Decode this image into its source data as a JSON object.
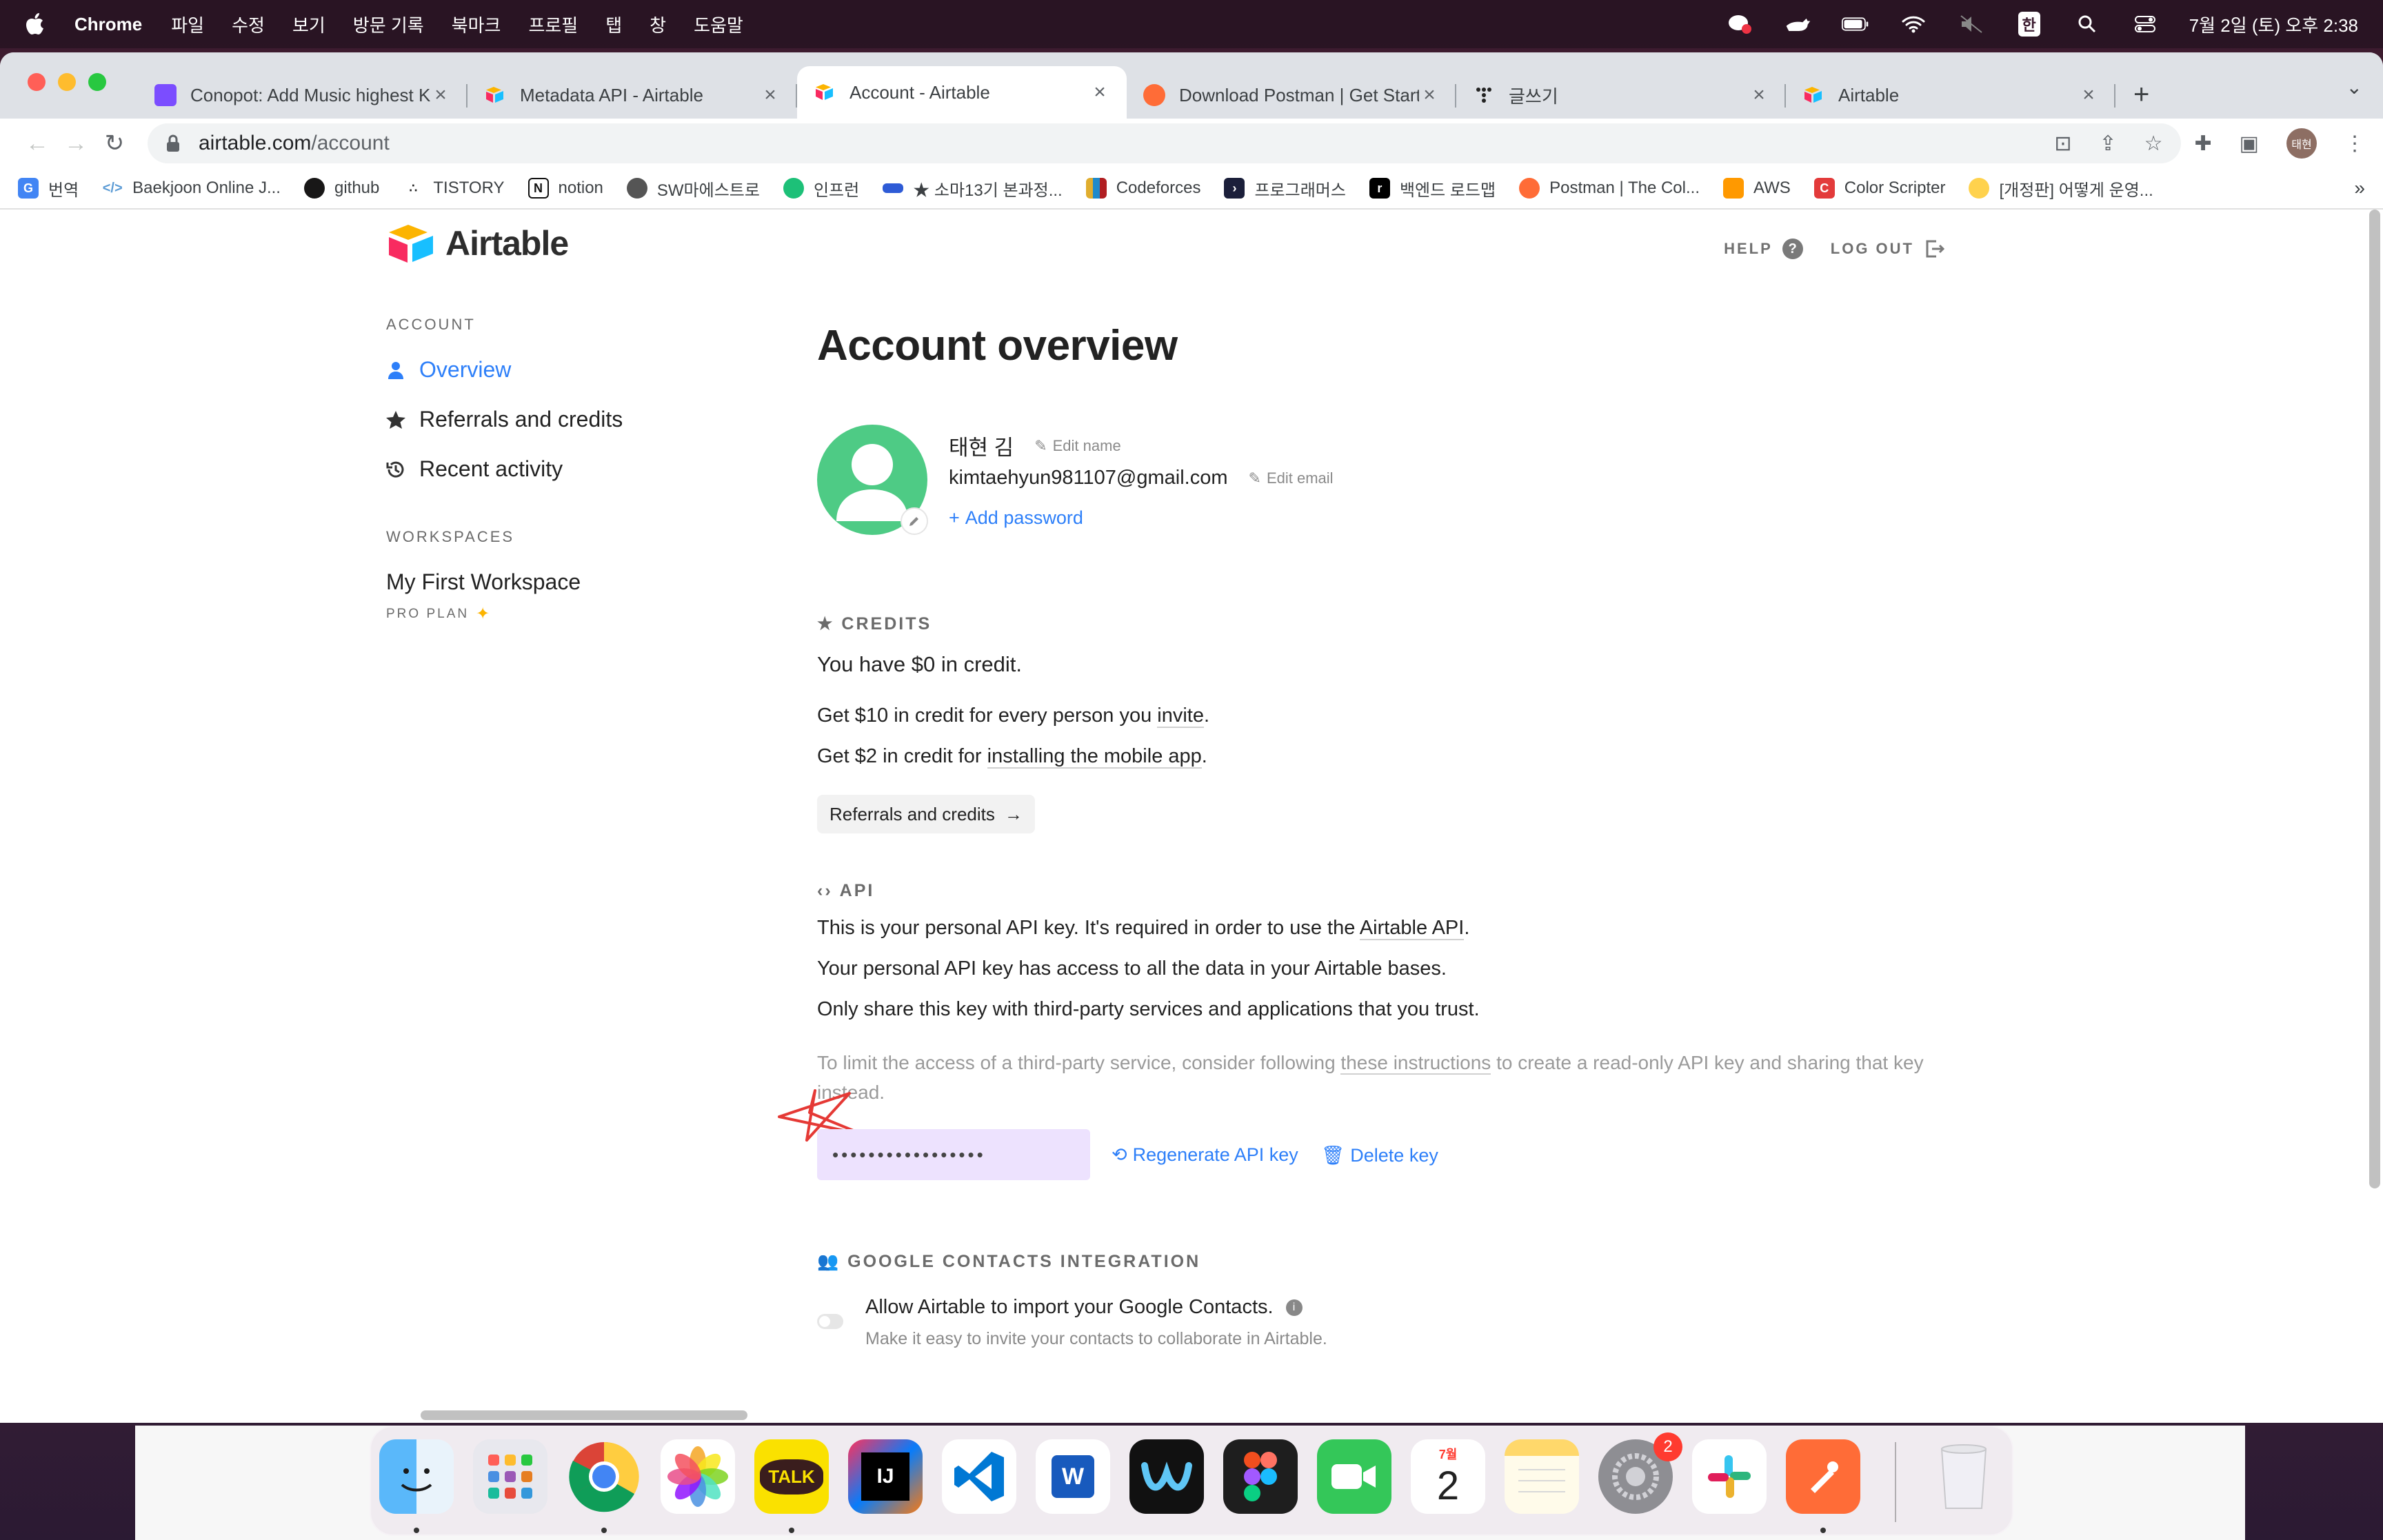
{
  "menubar": {
    "app_name": "Chrome",
    "menus": [
      "파일",
      "수정",
      "보기",
      "방문 기록",
      "북마크",
      "프로필",
      "탭",
      "창",
      "도움말"
    ],
    "datetime": "7월 2일 (토) 오후 2:38",
    "input_method": "한"
  },
  "browser": {
    "tabs": [
      {
        "title": "Conopot: Add Music highest Ke",
        "favicon": "rocket",
        "color": "#7b4dff"
      },
      {
        "title": "Metadata API - Airtable",
        "favicon": "airtable",
        "color": "#fcb400"
      },
      {
        "title": "Account - Airtable",
        "favicon": "airtable",
        "color": "#fcb400",
        "active": true
      },
      {
        "title": "Download Postman | Get Starte",
        "favicon": "postman",
        "color": "#ff6c37"
      },
      {
        "title": "글쓰기",
        "favicon": "tistory",
        "color": "#222222"
      },
      {
        "title": "Airtable",
        "favicon": "airtable",
        "color": "#fcb400"
      }
    ],
    "url_host": "airtable.com",
    "url_path": "/account",
    "profile_label": "태현",
    "bookmarks": [
      {
        "label": "번역",
        "icon_color": "#4285f4",
        "glyph": "G"
      },
      {
        "label": "Baekjoon Online J...",
        "icon_color": "#5b9bd5",
        "glyph": "</>"
      },
      {
        "label": "github",
        "icon_color": "#181717",
        "glyph": "●"
      },
      {
        "label": "TISTORY",
        "icon_color": "#222222",
        "glyph": "∴"
      },
      {
        "label": "notion",
        "icon_color": "#111111",
        "glyph": "N"
      },
      {
        "label": "SW마에스트로",
        "icon_color": "#555555",
        "glyph": "◍"
      },
      {
        "label": "인프런",
        "icon_color": "#1dc078",
        "glyph": "◎"
      },
      {
        "label": "★ 소마13기 본과정...",
        "icon_color": "#2e5bd6",
        "glyph": "▪▪"
      },
      {
        "label": "Codeforces",
        "icon_color": "#e0ad2e",
        "glyph": "▮"
      },
      {
        "label": "프로그래머스",
        "icon_color": "#1b1f3a",
        "glyph": "›"
      },
      {
        "label": "백엔드 로드맵",
        "icon_color": "#000000",
        "glyph": "r"
      },
      {
        "label": "Postman | The Col...",
        "icon_color": "#ff6c37",
        "glyph": "◐"
      },
      {
        "label": "AWS",
        "icon_color": "#ff9900",
        "glyph": "◆"
      },
      {
        "label": "Color Scripter",
        "icon_color": "#e33b3b",
        "glyph": "C"
      },
      {
        "label": "[개정판] 어떻게 운영...",
        "icon_color": "#ffd24d",
        "glyph": "●"
      }
    ]
  },
  "page": {
    "brand": "Airtable",
    "help_label": "HELP",
    "logout_label": "LOG OUT",
    "sidebar": {
      "account_heading": "ACCOUNT",
      "items": [
        {
          "label": "Overview",
          "icon": "user-icon",
          "active": true
        },
        {
          "label": "Referrals and credits",
          "icon": "star-icon"
        },
        {
          "label": "Recent activity",
          "icon": "history-icon"
        }
      ],
      "workspaces_heading": "WORKSPACES",
      "workspace_name": "My First Workspace",
      "workspace_plan": "PRO PLAN"
    },
    "title": "Account overview",
    "profile": {
      "name": "태현 김",
      "edit_name": "Edit name",
      "email": "kimtaehyun981107@gmail.com",
      "edit_email": "Edit email",
      "add_password": "Add password"
    },
    "credits": {
      "heading": "CREDITS",
      "balance": "You have $0 in credit.",
      "line1_prefix": "Get $10 in credit for every person you ",
      "line1_link": "invite",
      "line1_suffix": ".",
      "line2_prefix": "Get $2 in credit for ",
      "line2_link": "installing the mobile app",
      "line2_suffix": ".",
      "button": "Referrals and credits"
    },
    "api": {
      "heading": "API",
      "line1_prefix": "This is your personal API key. It's required in order to use the ",
      "line1_link": "Airtable API",
      "line1_suffix": ".",
      "line2": "Your personal API key has access to all the data in your Airtable bases.",
      "line3": "Only share this key with third-party services and applications that you trust.",
      "note_prefix": "To limit the access of a third-party service, consider following ",
      "note_link": "these instructions",
      "note_suffix": " to create a read-only API key and sharing that key instead.",
      "masked_key": "•••••••••••••••••",
      "regenerate": "Regenerate API key",
      "delete": "Delete key"
    },
    "google": {
      "heading": "GOOGLE CONTACTS INTEGRATION",
      "toggle_label": "Allow Airtable to import your Google Contacts.",
      "toggle_desc": "Make it easy to invite your contacts to collaborate in Airtable.",
      "enabled": false
    }
  },
  "dock": {
    "apps": [
      {
        "name": "Finder",
        "color": "#3ca0f5",
        "running": true
      },
      {
        "name": "Launchpad",
        "color": "#e8e8ee"
      },
      {
        "name": "Chrome",
        "color": "#ffffff",
        "running": true
      },
      {
        "name": "Photos",
        "color": "#ffffff"
      },
      {
        "name": "KakaoTalk",
        "color": "#fae100",
        "label": "TALK",
        "running": true
      },
      {
        "name": "IntelliJ IDEA",
        "color": "#000000",
        "label": "IJ"
      },
      {
        "name": "VS Code",
        "color": "#ffffff"
      },
      {
        "name": "Word",
        "color": "#185abd",
        "label": "W"
      },
      {
        "name": "Webex",
        "color": "#111111"
      },
      {
        "name": "Figma",
        "color": "#1e1e1e"
      },
      {
        "name": "FaceTime",
        "color": "#34c759"
      },
      {
        "name": "Calendar",
        "color": "#ffffff",
        "label": "2",
        "month": "7월"
      },
      {
        "name": "Notes",
        "color": "#fff7c2"
      },
      {
        "name": "System Preferences",
        "color": "#8e8e93",
        "badge": "2"
      },
      {
        "name": "Slack",
        "color": "#ffffff"
      },
      {
        "name": "Postman",
        "color": "#ff6c37",
        "running": true
      },
      {
        "name": "Trash",
        "color": "#f0f0f0"
      }
    ]
  },
  "colors": {
    "airtable_blue": "#2d7ff9",
    "avatar_green": "#4ecb85",
    "api_key_bg": "#ede2fe"
  }
}
